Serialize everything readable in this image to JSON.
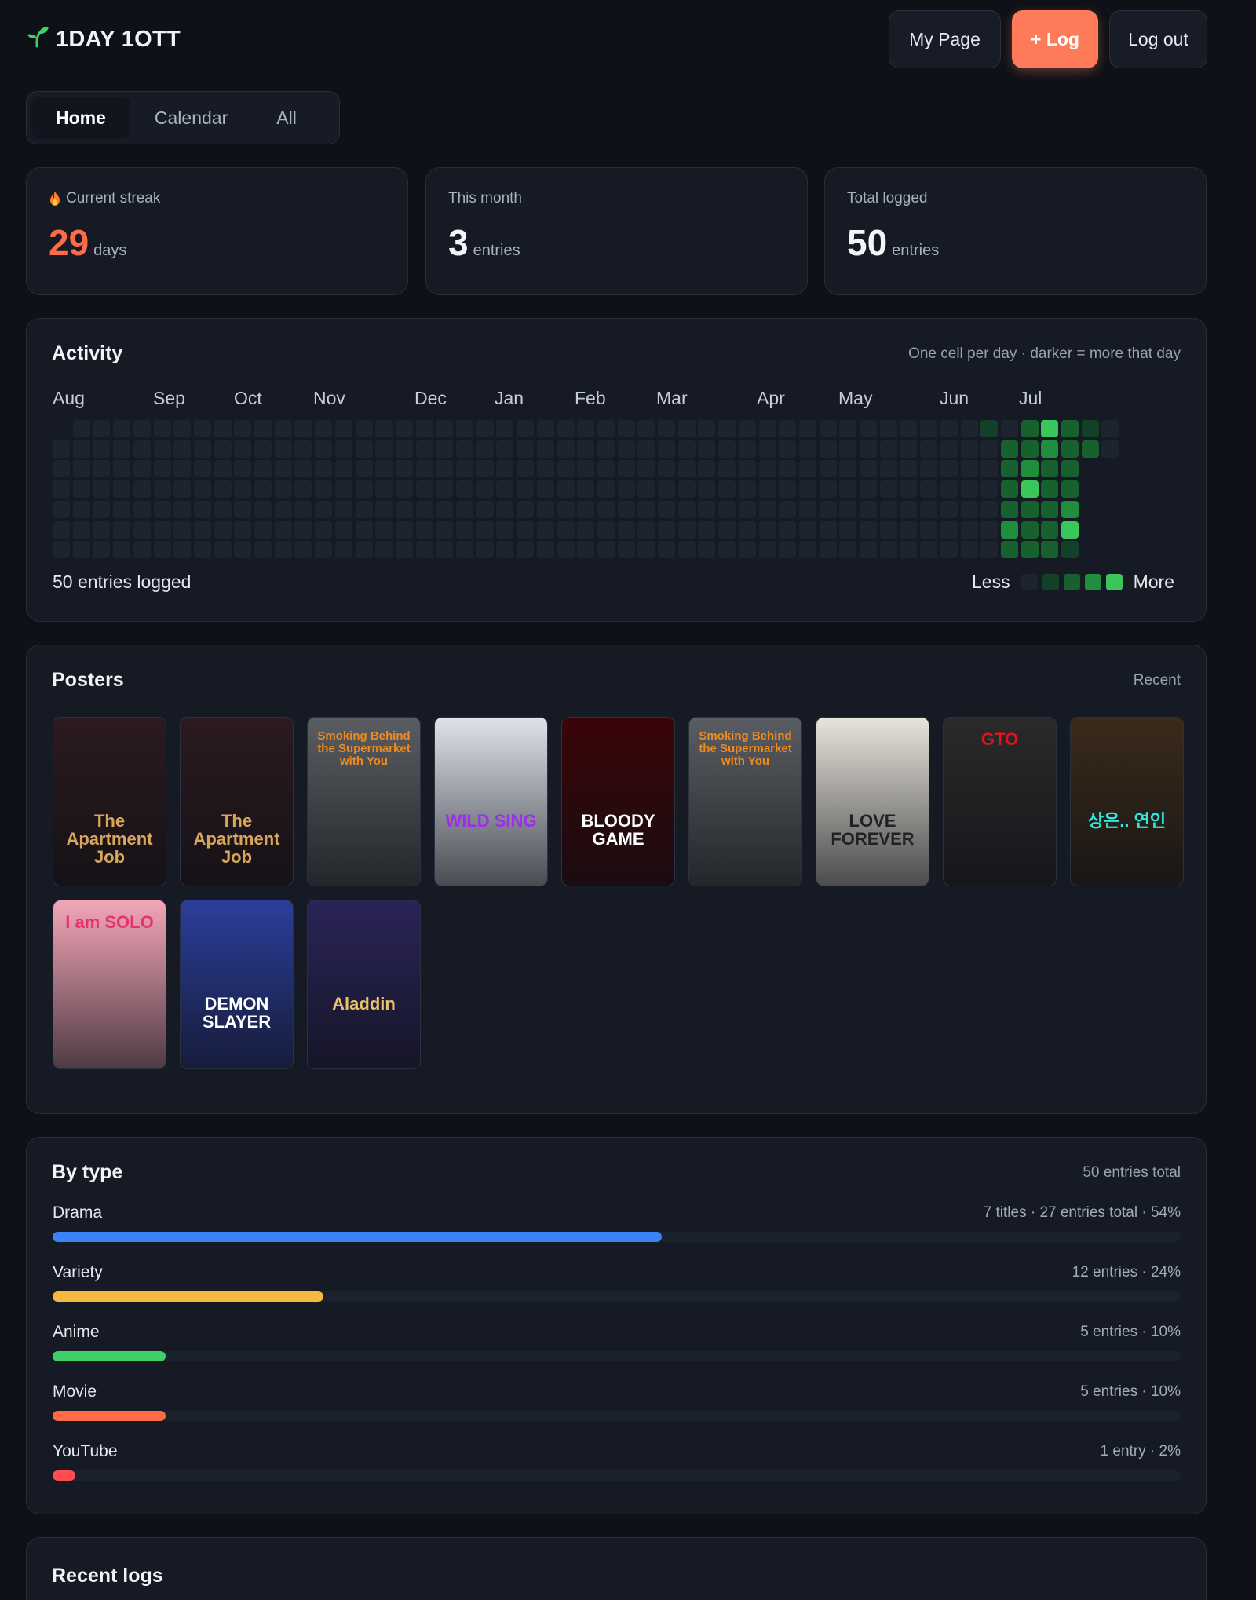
{
  "header": {
    "app_name": "1DAY 1OTT",
    "logo_icon": "sprout-icon",
    "my_page_label": "My Page",
    "log_label": "+ Log",
    "logout_label": "Log out"
  },
  "nav": {
    "tabs": [
      {
        "label": "Home",
        "active": true
      },
      {
        "label": "Calendar",
        "active": false
      },
      {
        "label": "All",
        "active": false
      }
    ]
  },
  "stats": [
    {
      "label": "Current streak",
      "icon": "flame-icon",
      "value": "29",
      "unit": "days"
    },
    {
      "label": "This month",
      "value": "3",
      "unit": "entries"
    },
    {
      "label": "Total logged",
      "value": "50",
      "unit": "entries"
    }
  ],
  "activity": {
    "title": "Activity",
    "note": "One cell per day · darker = more that day",
    "months": [
      "Aug",
      "Sep",
      "Oct",
      "Nov",
      "Dec",
      "Jan",
      "Feb",
      "Mar",
      "Apr",
      "May",
      "Jun",
      "Jul"
    ],
    "summary": "50 entries logged",
    "legend_less": "Less",
    "legend_more": "More",
    "colors": [
      "#1d2430",
      "#12412a",
      "#17612f",
      "#1f8f3d",
      "#39c75b"
    ],
    "active_cells": [
      {
        "week": 46,
        "day": 0,
        "level": 1
      },
      {
        "week": 47,
        "day": 0,
        "level": 0
      },
      {
        "week": 48,
        "day": 0,
        "level": 2
      },
      {
        "week": 49,
        "day": 0,
        "level": 4
      },
      {
        "week": 50,
        "day": 0,
        "level": 2
      },
      {
        "week": 51,
        "day": 0,
        "level": 1
      },
      {
        "week": 48,
        "day": 1,
        "level": 2
      },
      {
        "week": 49,
        "day": 1,
        "level": 3
      },
      {
        "week": 50,
        "day": 1,
        "level": 2
      },
      {
        "week": 51,
        "day": 1,
        "level": 2
      },
      {
        "week": 48,
        "day": 2,
        "level": 3
      },
      {
        "week": 49,
        "day": 2,
        "level": 2
      },
      {
        "week": 50,
        "day": 2,
        "level": 2
      },
      {
        "week": 48,
        "day": 3,
        "level": 4
      },
      {
        "week": 49,
        "day": 3,
        "level": 2
      },
      {
        "week": 50,
        "day": 3,
        "level": 2
      },
      {
        "week": 48,
        "day": 4,
        "level": 2
      },
      {
        "week": 49,
        "day": 4,
        "level": 2
      },
      {
        "week": 50,
        "day": 4,
        "level": 3
      },
      {
        "week": 47,
        "day": 5,
        "level": 3
      },
      {
        "week": 48,
        "day": 5,
        "level": 2
      },
      {
        "week": 49,
        "day": 5,
        "level": 2
      },
      {
        "week": 50,
        "day": 5,
        "level": 4
      },
      {
        "week": 47,
        "day": 6,
        "level": 2
      },
      {
        "week": 48,
        "day": 6,
        "level": 2
      },
      {
        "week": 49,
        "day": 6,
        "level": 2
      },
      {
        "week": 50,
        "day": 6,
        "level": 1
      },
      {
        "week": 47,
        "day": 1,
        "level": 2
      },
      {
        "week": 47,
        "day": 2,
        "level": 2
      },
      {
        "week": 47,
        "day": 3,
        "level": 2
      },
      {
        "week": 47,
        "day": 4,
        "level": 2
      }
    ]
  },
  "posters": {
    "title": "Posters",
    "sort_label": "Recent",
    "items": [
      {
        "title": "The Apartment Job",
        "bg": "#2b1a1f",
        "accent": "#d8a65a"
      },
      {
        "title": "The Apartment Job",
        "bg": "#2b1a1f",
        "accent": "#d8a65a"
      },
      {
        "title": "Smoking Behind the Supermarket with You",
        "bg": "#5a5e63",
        "accent": "#f08a1c"
      },
      {
        "title": "WILD SING",
        "bg": "#dfe3ea",
        "accent": "#9b2cf0"
      },
      {
        "title": "BLOODY GAME",
        "bg": "#3a0508",
        "accent": "#ffffff"
      },
      {
        "title": "Smoking Behind the Supermarket with You",
        "bg": "#5a5e63",
        "accent": "#f08a1c"
      },
      {
        "title": "LOVE FOREVER",
        "bg": "#e8e4dc",
        "accent": "#222222"
      },
      {
        "title": "GTO",
        "bg": "#2a2a2a",
        "accent": "#e0141c"
      },
      {
        "title": "상은.. 연인",
        "bg": "#3a2a1a",
        "accent": "#2ee8e0"
      },
      {
        "title": "I am SOLO",
        "bg": "#f3a6b8",
        "accent": "#e6336f"
      },
      {
        "title": "DEMON SLAYER",
        "bg": "#2b3e9a",
        "accent": "#ffffff"
      },
      {
        "title": "Aladdin",
        "bg": "#2a2458",
        "accent": "#e8c16a"
      }
    ]
  },
  "by_type": {
    "title": "By type",
    "total_label": "50 entries total",
    "rows": [
      {
        "name": "Drama",
        "meta": "7 titles · 27 entries total · 54%",
        "fraction": 0.54,
        "color": "#3b82f6"
      },
      {
        "name": "Variety",
        "meta": "12 entries · 24%",
        "fraction": 0.24,
        "color": "#f5b942"
      },
      {
        "name": "Anime",
        "meta": "5 entries · 10%",
        "fraction": 0.1,
        "color": "#3fcf67"
      },
      {
        "name": "Movie",
        "meta": "5 entries · 10%",
        "fraction": 0.1,
        "color": "#ff6a47"
      },
      {
        "name": "YouTube",
        "meta": "1 entry · 2%",
        "fraction": 0.02,
        "color": "#ff4d4f"
      }
    ]
  },
  "recent_logs": {
    "title": "Recent logs"
  }
}
